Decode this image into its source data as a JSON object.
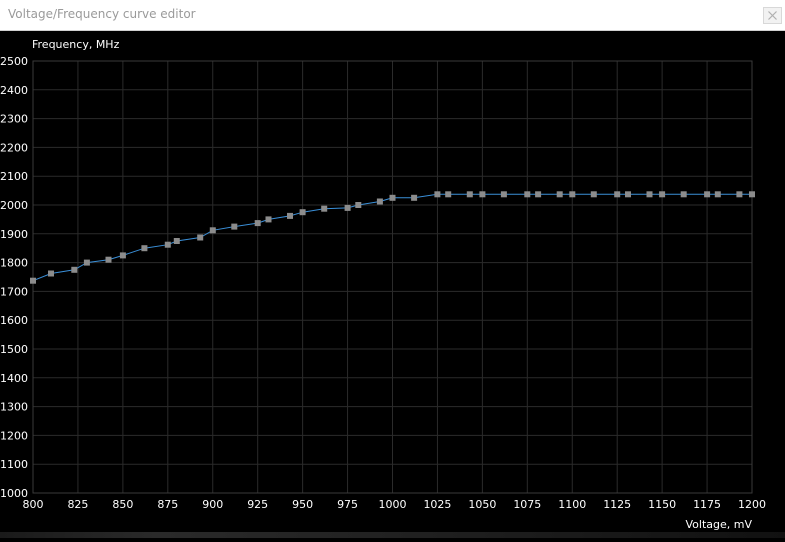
{
  "window": {
    "title": "Voltage/Frequency curve editor"
  },
  "colors": {
    "background": "#000000",
    "grid": "#2b2b2b",
    "axis_text": "#ffffff",
    "curve": "#3a8fd8",
    "point": "#8c8c8c"
  },
  "chart_data": {
    "type": "line",
    "ylabel": "Frequency, MHz",
    "xlabel": "Voltage, mV",
    "xlim": [
      800,
      1200
    ],
    "ylim": [
      1000,
      2500
    ],
    "x_ticks": [
      "800",
      "825",
      "850",
      "875",
      "900",
      "925",
      "950",
      "975",
      "1000",
      "1025",
      "1050",
      "1075",
      "1100",
      "1125",
      "1150",
      "1175",
      "1200"
    ],
    "y_ticks": [
      "2500",
      "2400",
      "2300",
      "2200",
      "2100",
      "2000",
      "1900",
      "1800",
      "1700",
      "1600",
      "1500",
      "1400",
      "1300",
      "1200",
      "1100",
      "1000"
    ],
    "grid": true,
    "series": [
      {
        "x": [
          800,
          810,
          823,
          830,
          842,
          850,
          862,
          875,
          880,
          893,
          900,
          912,
          925,
          931,
          943,
          950,
          962,
          975,
          981,
          993,
          1000,
          1012,
          1025,
          1031,
          1043,
          1050,
          1062,
          1075,
          1081,
          1093,
          1100,
          1112,
          1125,
          1131,
          1143,
          1150,
          1162,
          1175,
          1181,
          1193,
          1200
        ],
        "y": [
          1737,
          1762,
          1775,
          1800,
          1810,
          1825,
          1850,
          1862,
          1875,
          1887,
          1912,
          1925,
          1937,
          1950,
          1962,
          1975,
          1987,
          1990,
          2000,
          2012,
          2025,
          2025,
          2037,
          2037,
          2037,
          2037,
          2037,
          2037,
          2037,
          2037,
          2037,
          2037,
          2037,
          2037,
          2037,
          2037,
          2037,
          2037,
          2037,
          2037,
          2037
        ]
      }
    ]
  }
}
